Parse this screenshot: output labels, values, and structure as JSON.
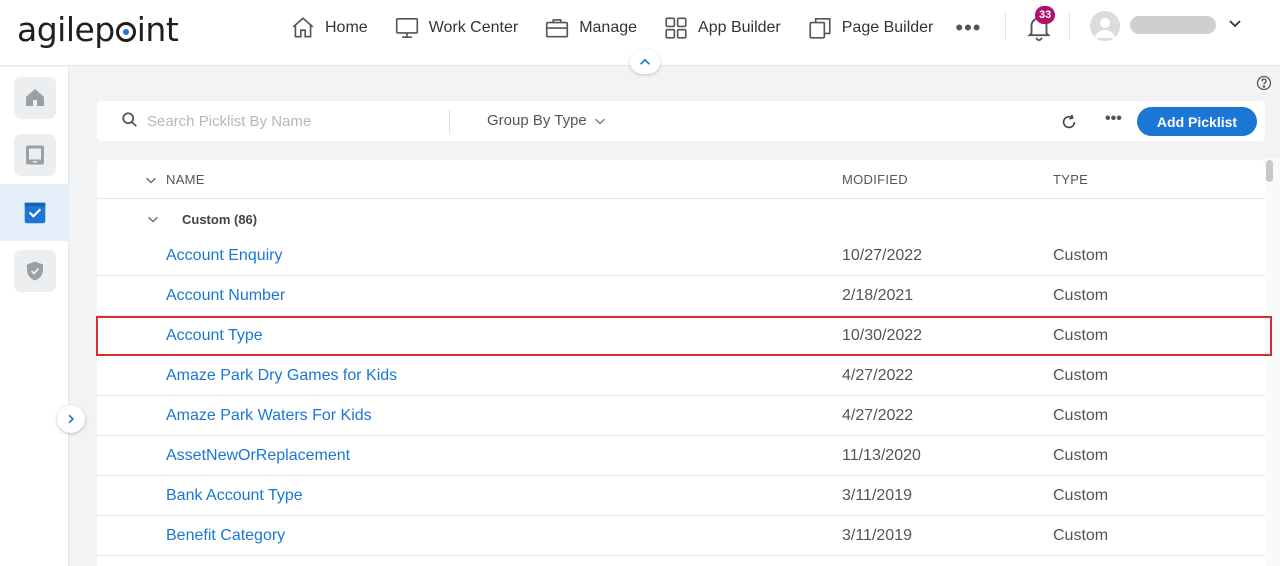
{
  "brand": {
    "logo_pre": "agilep",
    "logo_post": "int"
  },
  "nav": {
    "items": [
      {
        "label": "Home",
        "icon": "home-icon"
      },
      {
        "label": "Work Center",
        "icon": "monitor-icon"
      },
      {
        "label": "Manage",
        "icon": "briefcase-icon"
      },
      {
        "label": "App Builder",
        "icon": "grid-icon"
      },
      {
        "label": "Page Builder",
        "icon": "pages-icon"
      }
    ],
    "more": "•••",
    "notifications": "33"
  },
  "rail": {
    "items": [
      {
        "icon": "home-icon",
        "active": false
      },
      {
        "icon": "tablet-icon",
        "active": false
      },
      {
        "icon": "picklist-icon",
        "active": true
      },
      {
        "icon": "shield-icon",
        "active": false
      }
    ]
  },
  "toolbar": {
    "search_placeholder": "Search Picklist By Name",
    "group_by": "Group By Type",
    "more": "•••",
    "add_label": "Add Picklist"
  },
  "table": {
    "headers": {
      "name": "NAME",
      "modified": "MODIFIED",
      "type": "TYPE"
    },
    "group": "Custom (86)",
    "rows": [
      {
        "name": "Account Enquiry",
        "modified": "10/27/2022",
        "type": "Custom"
      },
      {
        "name": "Account Number",
        "modified": "2/18/2021",
        "type": "Custom"
      },
      {
        "name": "Account Type",
        "modified": "10/30/2022",
        "type": "Custom"
      },
      {
        "name": "Amaze Park Dry Games for Kids",
        "modified": "4/27/2022",
        "type": "Custom"
      },
      {
        "name": "Amaze Park Waters For Kids",
        "modified": "4/27/2022",
        "type": "Custom"
      },
      {
        "name": "AssetNewOrReplacement",
        "modified": "11/13/2020",
        "type": "Custom"
      },
      {
        "name": "Bank Account Type",
        "modified": "3/11/2019",
        "type": "Custom"
      },
      {
        "name": "Benefit Category",
        "modified": "3/11/2019",
        "type": "Custom"
      }
    ]
  },
  "colors": {
    "accent": "#1b76d6",
    "highlight": "#d32f2f",
    "badge": "#b0106b"
  }
}
